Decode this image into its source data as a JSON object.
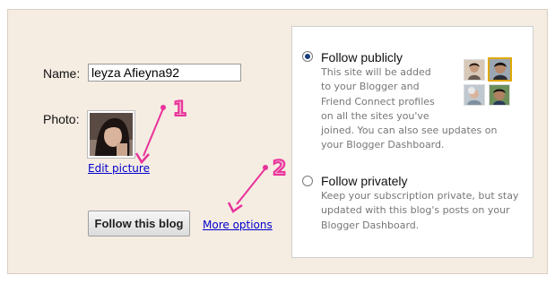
{
  "form": {
    "name_label": "Name:",
    "name_value": "leyza Afieyna92",
    "photo_label": "Photo:",
    "edit_picture_link": "Edit picture",
    "follow_button": "Follow this blog",
    "more_options_link": "More options"
  },
  "options": {
    "public": {
      "title": "Follow publicly",
      "selected": true,
      "description_lines": [
        "This site will be added",
        "to your Blogger and",
        "Friend Connect profiles",
        "on all the sites you've",
        "joined. You can also see updates on",
        "your Blogger Dashboard."
      ]
    },
    "private": {
      "title": "Follow privately",
      "selected": false,
      "description_lines": [
        "Keep your subscription private, but stay",
        "updated with this blog's posts on your",
        "Blogger Dashboard."
      ]
    }
  },
  "annotations": {
    "marker_1": "1",
    "marker_2": "2",
    "color": "#e8329a"
  },
  "colors": {
    "panel_bg": "#f5ece2",
    "link": "#0000cc",
    "description_text": "#777777"
  }
}
